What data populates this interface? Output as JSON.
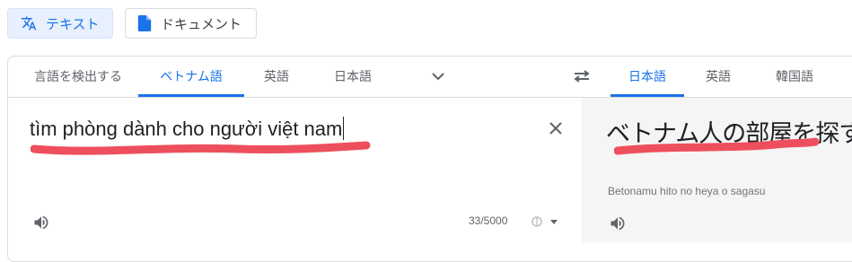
{
  "modes": {
    "text_label": "テキスト",
    "document_label": "ドキュメント"
  },
  "source_langs": [
    "言語を検出する",
    "ベトナム語",
    "英語",
    "日本語"
  ],
  "target_langs": [
    "日本語",
    "英語",
    "韓国語"
  ],
  "source": {
    "text": "tìm phòng dành cho người việt nam",
    "char_count": "33/5000"
  },
  "target": {
    "text": "ベトナム人の部屋を探す",
    "romanization": "Betonamu hito no heya o sagasu"
  },
  "colors": {
    "accent": "#1a73e8",
    "annotation": "#ee4f5c"
  },
  "icons": [
    "translate-icon",
    "document-icon",
    "chevron-down-icon",
    "swap-icon",
    "close-icon",
    "speaker-icon",
    "handwriting-icon"
  ]
}
